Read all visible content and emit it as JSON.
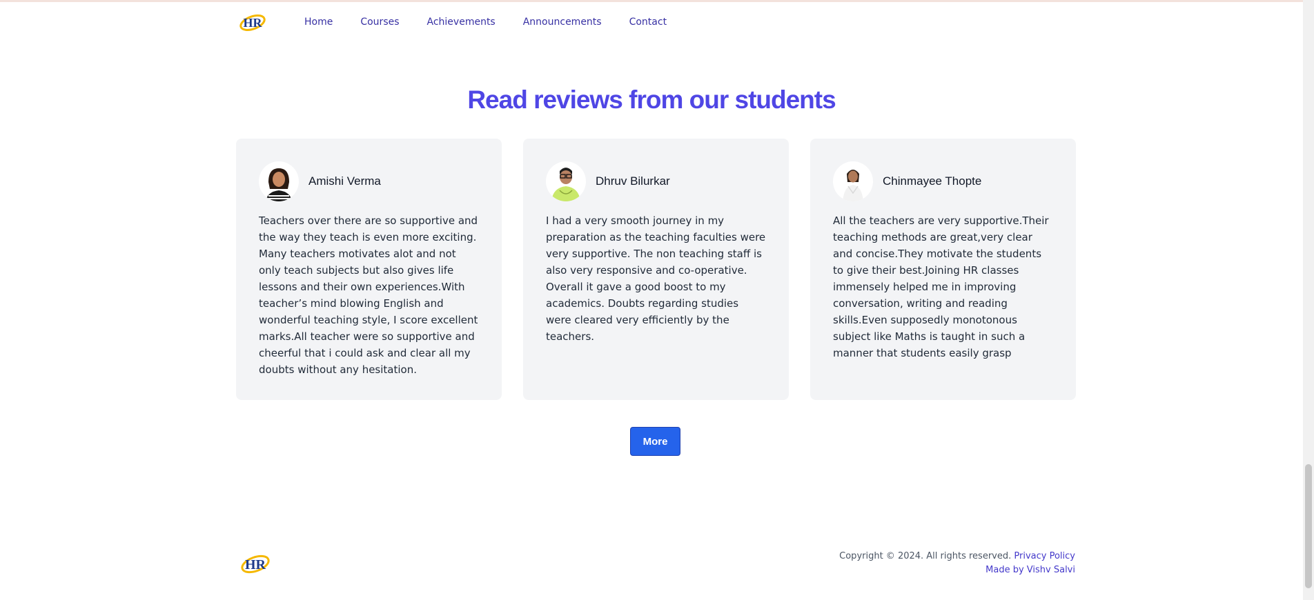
{
  "nav": {
    "logo_alt": "HR",
    "links": [
      "Home",
      "Courses",
      "Achievements",
      "Announcements",
      "Contact"
    ]
  },
  "reviews": {
    "title": "Read reviews from our students",
    "items": [
      {
        "name": "Amishi Verma",
        "text": "Teachers over there are so supportive and the way they teach is even more exciting. Many teachers motivates alot and not only teach subjects but also gives life lessons and their own experiences.With teacher’s mind blowing English and wonderful teaching style, I score excellent marks.All teacher were so supportive and cheerful that i could ask and clear all my doubts without any hesitation."
      },
      {
        "name": "Dhruv Bilurkar",
        "text": "I had a very smooth journey in my preparation as the teaching faculties were very supportive. The non teaching staff is also very responsive and co-operative. Overall it gave a good boost to my academics. Doubts regarding studies were cleared very efficiently by the teachers."
      },
      {
        "name": "Chinmayee Thopte",
        "text": "All the teachers are very supportive.Their teaching methods are great,very clear and concise.They motivate the students to give their best.Joining HR classes immensely helped me in improving conversation, writing and reading skills.Even supposedly monotonous subject like Maths is taught in such a manner that students easily grasp"
      }
    ],
    "more_label": "More"
  },
  "footer": {
    "copyright": "Copyright © 2024. All rights reserved.",
    "privacy_label": "Privacy Policy",
    "made_by": "Made by Vishv Salvi"
  },
  "colors": {
    "brand": "#4f46e5",
    "button": "#2563eb",
    "card_bg": "#f3f4f6",
    "logo_ring": "#f5b800",
    "logo_text": "#1e3a8a"
  }
}
